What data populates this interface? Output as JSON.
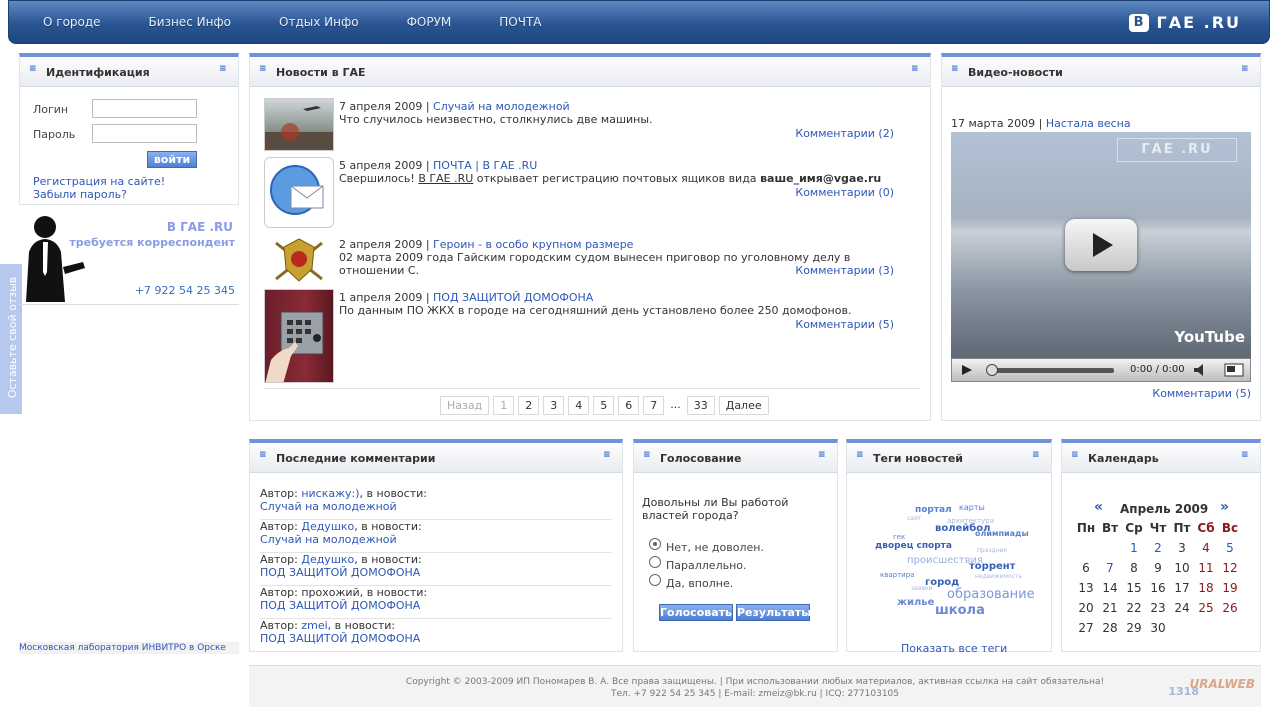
{
  "nav": {
    "items": [
      "О городе",
      "Бизнес Инфо",
      "Отдых Инфо",
      "ФОРУМ",
      "ПОЧТА"
    ],
    "logo": "ГАЕ .RU",
    "logo_mark": "В"
  },
  "auth": {
    "title": "Идентификация",
    "login_label": "Логин",
    "password_label": "Пароль",
    "login_button": "войти",
    "register_link": "Регистрация на сайте!",
    "forgot_link": "Забыли пароль?"
  },
  "ad": {
    "site": "В ГАЕ .RU",
    "text": "требуется корреспондент",
    "phone": "+7 922 54 25 345"
  },
  "sidebar_link": "Московская лаборатория ИНВИТРО в Орске",
  "feedback_tab": "Оставьте свой отзыв",
  "news": {
    "title": "Новости в ГАЕ",
    "items": [
      {
        "date": "7 апреля 2009 |",
        "headline": "Случай на молодежной",
        "body": "Что случилось неизвестно, столкнулись две машины.",
        "comments": "Комментарии (2)"
      },
      {
        "date": "5 апреля 2009 |",
        "headline": "ПОЧТА | В ГАЕ .RU",
        "body_pre": "Свершилось!",
        "body_link": "В ГАЕ .RU",
        "body_mid": "открывает регистрацию почтовых ящиков вида",
        "body_bold": "ваше_имя@vgae.ru",
        "comments": "Комментарии (0)"
      },
      {
        "date": "2 апреля 2009 |",
        "headline": "Героин - в особо крупном размере",
        "body": "02 марта 2009 года Гайским городским судом вынесен приговор по уголовному делу  в отношении С.",
        "comments": "Комментарии (3)"
      },
      {
        "date": "1 апреля 2009 |",
        "headline": "ПОД ЗАЩИТОЙ ДОМОФОНА",
        "body": "По данным ПО ЖКХ в городе на сегодняшний день установлено более 250 домофонов.",
        "comments": "Комментарии (5)"
      }
    ],
    "pager": {
      "prev": "Назад",
      "pages": [
        "1",
        "2",
        "3",
        "4",
        "5",
        "6",
        "7"
      ],
      "ellipsis": "...",
      "last": "33",
      "next": "Далее"
    }
  },
  "video": {
    "title": "Видео-новости",
    "date": "17 марта 2009 |",
    "headline": "Настала весна",
    "time": "0:00 / 0:00",
    "watermark": "ГАЕ .RU",
    "yt": "YouTube",
    "comments": "Комментарии (5)"
  },
  "comments": {
    "title": "Последние комментарии",
    "items": [
      {
        "author_label": "Автор:",
        "author": "нискажу:)",
        "suffix": ", в новости:",
        "news": "Случай на молодежной",
        "author_linked": true
      },
      {
        "author_label": "Автор:",
        "author": "Дедушко",
        "suffix": ", в новости:",
        "news": "Случай на молодежной",
        "author_linked": true
      },
      {
        "author_label": "Автор:",
        "author": "Дедушко",
        "suffix": ", в новости:",
        "news": "ПОД ЗАЩИТОЙ ДОМОФОНА",
        "author_linked": true
      },
      {
        "author_label": "Автор:",
        "author": "прохожий",
        "suffix": ", в новости:",
        "news": "ПОД ЗАЩИТОЙ ДОМОФОНА",
        "author_linked": false
      },
      {
        "author_label": "Автор:",
        "author": "zmei",
        "suffix": ", в новости:",
        "news": "ПОД ЗАЩИТОЙ ДОМОФОНА",
        "author_linked": true
      }
    ]
  },
  "poll": {
    "title": "Голосование",
    "question": "Довольны ли Вы работой властей города?",
    "options": [
      "Нет, не доволен.",
      "Параллельно.",
      "Да, вполне."
    ],
    "selected": 0,
    "vote_button": "Голосовать",
    "results_button": "Результаты"
  },
  "tags": {
    "title": "Теги новостей",
    "show_all": "Показать все теги",
    "words": [
      "портал",
      "карты",
      "волейбол",
      "олимпиады",
      "дворец спорта",
      "происшествия",
      "торрент",
      "образование",
      "город",
      "школа",
      "жилье",
      "квартира",
      "гек",
      "сайт",
      "архитектура",
      "праздник",
      "заявки",
      "недвижимость"
    ]
  },
  "calendar": {
    "title": "Календарь",
    "prev": "«",
    "next": "»",
    "month": "Апрель 2009",
    "weekdays": [
      "Пн",
      "Вт",
      "Ср",
      "Чт",
      "Пт",
      "Сб",
      "Вс"
    ],
    "weeks": [
      [
        "",
        "",
        "1",
        "2",
        "3",
        "4",
        "5"
      ],
      [
        "6",
        "7",
        "8",
        "9",
        "10",
        "11",
        "12"
      ],
      [
        "13",
        "14",
        "15",
        "16",
        "17",
        "18",
        "19"
      ],
      [
        "20",
        "21",
        "22",
        "23",
        "24",
        "25",
        "26"
      ],
      [
        "27",
        "28",
        "29",
        "30",
        "",
        "",
        ""
      ]
    ],
    "linked_days": [
      "1",
      "2",
      "5",
      "7"
    ]
  },
  "footer": {
    "line1": "Copyright © 2003-2009 ИП Пономарев В. А. Все права защищены. | При использовании любых материалов, активная ссылка на сайт обязательна!",
    "line2": "Тел. +7 922 54 25 345 | E-mail: zmeiz@bk.ru | ICQ: 277103105",
    "counter": "1318",
    "brand": "URALWEB"
  },
  "colors": {
    "accent": "#6f93d9",
    "link": "#2e57b8",
    "nav_bg": "#2a5592"
  }
}
